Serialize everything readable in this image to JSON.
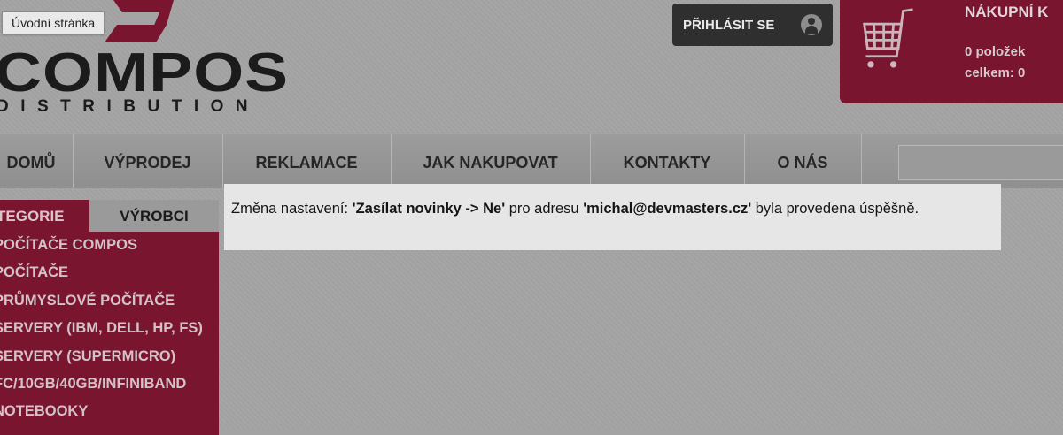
{
  "tooltip": {
    "text": "Úvodní stránka"
  },
  "logo": {
    "title": "COMPOS",
    "subtitle": "DISTRIBUTION"
  },
  "header": {
    "login_label": "PŘIHLÁSIT SE"
  },
  "cart": {
    "title": "NÁKUPNÍ K",
    "count": "0 položek",
    "total": "celkem: 0"
  },
  "nav": {
    "items": [
      {
        "label": "DOMŮ"
      },
      {
        "label": "VÝPRODEJ"
      },
      {
        "label": "REKLAMACE"
      },
      {
        "label": "JAK NAKUPOVAT"
      },
      {
        "label": "KONTAKTY"
      },
      {
        "label": "O NÁS"
      }
    ]
  },
  "sidebar": {
    "tabs": [
      {
        "label": "TEGORIE"
      },
      {
        "label": "VÝROBCI"
      }
    ],
    "items": [
      {
        "label": "POČÍTAČE COMPOS"
      },
      {
        "label": "POČÍTAČE"
      },
      {
        "label": "PRŮMYSLOVÉ POČÍTAČE"
      },
      {
        "label": "SERVERY (IBM, DELL, HP, FS)"
      },
      {
        "label": "SERVERY (SUPERMICRO)"
      },
      {
        "label": "FC/10GB/40GB/INFINIBAND"
      },
      {
        "label": "NOTEBOOKY"
      }
    ]
  },
  "flash": {
    "prefix": "Změna nastavení: ",
    "setting": "'Zasílat novinky -> Ne'",
    "middle": " pro adresu ",
    "email": "'michal@devmasters.cz'",
    "suffix": " byla provedena úspěšně."
  },
  "colors": {
    "brand": "#7a1530",
    "background": "#a4a4a4",
    "login_bg": "#2f2f2f"
  },
  "icons": {
    "user": "user-icon",
    "cart": "cart-icon"
  }
}
